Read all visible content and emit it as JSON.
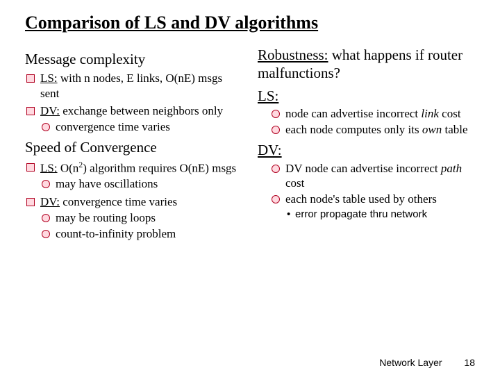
{
  "title": "Comparison of LS and DV algorithms",
  "left": {
    "sec1": "Message complexity",
    "ls1_pre": "LS:",
    "ls1_post": " with n nodes, E links, O(nE) msgs sent",
    "dv1_pre": "DV:",
    "dv1_post": " exchange between neighbors only",
    "dv1_sub1": "convergence time varies",
    "sec2": "Speed of Convergence",
    "ls2_pre": "LS:",
    "ls2_mid": " O(n",
    "ls2_sup": "2",
    "ls2_post": ") algorithm requires O(nE) msgs",
    "ls2_sub1": "may have oscillations",
    "dv2_pre": "DV:",
    "dv2_post": " convergence time varies",
    "dv2_sub1": "may be routing loops",
    "dv2_sub2": "count-to-infinity problem"
  },
  "right": {
    "sec1a": "Robustness:",
    "sec1b": " what happens if router malfunctions?",
    "ls_head": "LS:",
    "ls_c1a": "node can advertise incorrect ",
    "ls_c1b": "link",
    "ls_c1c": " cost",
    "ls_c2a": "each node computes only its ",
    "ls_c2b": "own",
    "ls_c2c": " table",
    "dv_head": "DV:",
    "dv_c1a": "DV node can advertise incorrect ",
    "dv_c1b": "path",
    "dv_c1c": " cost",
    "dv_c2": "each node's table used by others",
    "dv_c2_sub": "error propagate thru network"
  },
  "footer": {
    "label": "Network Layer",
    "page": "18"
  }
}
